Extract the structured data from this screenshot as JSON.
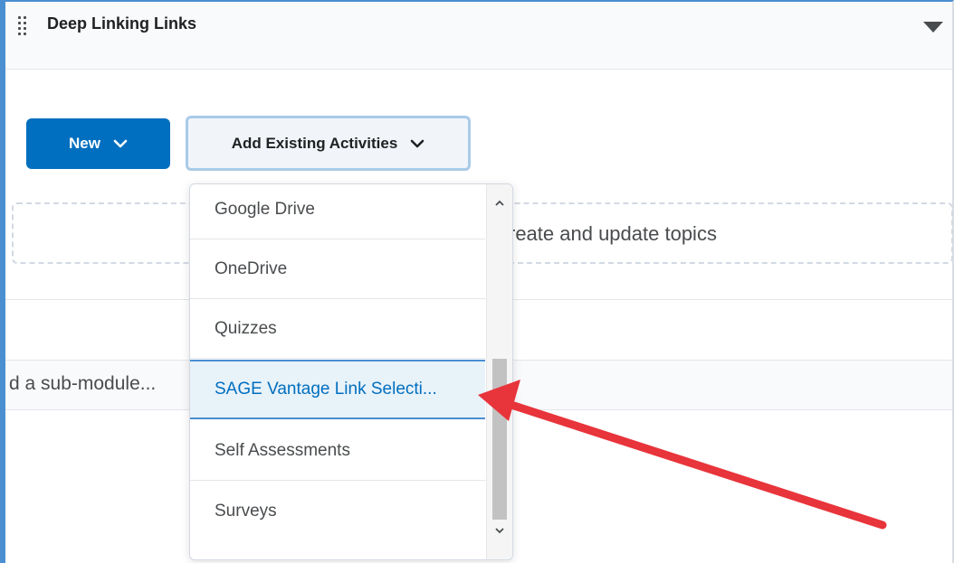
{
  "module": {
    "title": "Deep Linking Links"
  },
  "buttons": {
    "new_label": "New",
    "add_existing_label": "Add Existing Activities"
  },
  "dropzone": {
    "text": "reate and update topics"
  },
  "submodule": {
    "placeholder_text": "d a sub-module..."
  },
  "menu": {
    "items": [
      {
        "label": "Google Drive"
      },
      {
        "label": "OneDrive"
      },
      {
        "label": "Quizzes"
      },
      {
        "label": "SAGE Vantage Link Selecti..."
      },
      {
        "label": "Self Assessments"
      },
      {
        "label": "Surveys"
      }
    ],
    "selected_index": 3
  },
  "colors": {
    "accent": "#006fbf",
    "annotation_arrow": "#e8343b",
    "focus_border": "#4a8fd1"
  },
  "icons": [
    "drag-handle-icon",
    "collapse-triangle-icon",
    "chevron-down-icon",
    "scroll-up-icon",
    "scroll-down-icon",
    "annotation-arrow"
  ]
}
